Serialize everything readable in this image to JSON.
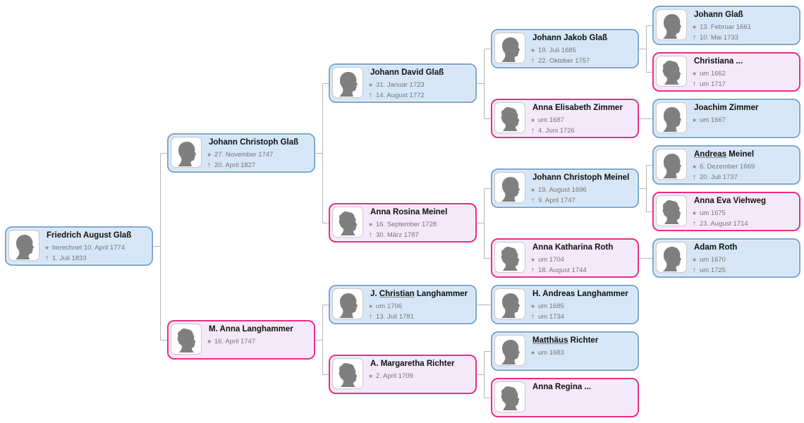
{
  "app": {
    "view": "Ahnenbaum"
  },
  "colors": {
    "male_border": "#7aa6cf",
    "male_bg": "#d6e6f7",
    "female_border": "#ec2a86",
    "female_bg": "#f3e9f8",
    "connector": "#b5b5b5"
  },
  "symbols": {
    "birth": "★",
    "death": "†"
  },
  "persons": [
    {
      "id": "p0",
      "gen": 0,
      "sex": "m",
      "name": "Friedrich August Glaß",
      "name_parts": [
        "Friedrich August Glaß"
      ],
      "birth": "berechnet 10. April 1774",
      "death": "1. Juli 1833"
    },
    {
      "id": "p1",
      "gen": 1,
      "sex": "m",
      "name": "Johann Christoph Glaß",
      "name_parts": [
        "Johann Christoph Glaß"
      ],
      "birth": "27. November 1747",
      "death": "20. April 1827"
    },
    {
      "id": "p2",
      "gen": 1,
      "sex": "f",
      "name": "M. Anna Langhammer",
      "name_parts": [
        "M. Anna Langhammer"
      ],
      "birth": "16. April 1747",
      "death": null
    },
    {
      "id": "p3",
      "gen": 2,
      "sex": "m",
      "name": "Johann David Glaß",
      "name_parts": [
        "Johann David Glaß"
      ],
      "birth": "31. Januar 1723",
      "death": "14. August 1772"
    },
    {
      "id": "p4",
      "gen": 2,
      "sex": "f",
      "name": "Anna Rosina Meinel",
      "name_parts": [
        "Anna Rosina Meinel"
      ],
      "birth": "16. September 1728",
      "death": "30. März 1787"
    },
    {
      "id": "p5",
      "gen": 2,
      "sex": "m",
      "name": "J. Christian Langhammer",
      "name_parts": [
        "J. ",
        "Christian",
        " Langhammer"
      ],
      "underline_index": 1,
      "birth": "um 1706",
      "death": "13. Juli 1781"
    },
    {
      "id": "p6",
      "gen": 2,
      "sex": "f",
      "name": "A. Margaretha Richter",
      "name_parts": [
        "A. Margaretha Richter"
      ],
      "birth": "2. April 1709",
      "death": null
    },
    {
      "id": "p7",
      "gen": 3,
      "sex": "m",
      "name": "Johann Jakob Glaß",
      "name_parts": [
        "Johann Jakob Glaß"
      ],
      "birth": "19. Juli 1685",
      "death": "22. Oktober 1757"
    },
    {
      "id": "p8",
      "gen": 3,
      "sex": "f",
      "name": "Anna Elisabeth Zimmer",
      "name_parts": [
        "Anna Elisabeth Zimmer"
      ],
      "birth": "um 1687",
      "death": "4. Juni 1726"
    },
    {
      "id": "p9",
      "gen": 3,
      "sex": "m",
      "name": "Johann Christoph Meinel",
      "name_parts": [
        "Johann Christoph Meinel"
      ],
      "birth": "19. August 1696",
      "death": "9. April 1747"
    },
    {
      "id": "p10",
      "gen": 3,
      "sex": "f",
      "name": "Anna Katharina Roth",
      "name_parts": [
        "Anna Katharina Roth"
      ],
      "birth": "um 1704",
      "death": "18. August 1744"
    },
    {
      "id": "p11",
      "gen": 3,
      "sex": "m",
      "name": "H. Andreas Langhammer",
      "name_parts": [
        "H. Andreas Langhammer"
      ],
      "birth": "um 1685",
      "death": "um 1734"
    },
    {
      "id": "p12",
      "gen": 3,
      "sex": "m",
      "name": "Matthäus Richter",
      "name_parts": [
        "",
        "Matthäus",
        " Richter"
      ],
      "underline_index": 1,
      "birth": "um 1683",
      "death": null
    },
    {
      "id": "p13",
      "gen": 3,
      "sex": "f",
      "name": "Anna Regina ...",
      "name_parts": [
        "Anna Regina ..."
      ],
      "birth": null,
      "death": null
    },
    {
      "id": "p14",
      "gen": 4,
      "sex": "m",
      "name": "Johann Glaß",
      "name_parts": [
        "Johann Glaß"
      ],
      "birth": "13. Februar 1661",
      "death": "10. Mai 1733"
    },
    {
      "id": "p15",
      "gen": 4,
      "sex": "f",
      "name": "Christiana ...",
      "name_parts": [
        "Christiana ..."
      ],
      "birth": "um 1662",
      "death": "um 1717"
    },
    {
      "id": "p16",
      "gen": 4,
      "sex": "m",
      "name": "Joachim Zimmer",
      "name_parts": [
        "Joachim Zimmer"
      ],
      "birth": "um 1667",
      "death": null
    },
    {
      "id": "p17",
      "gen": 4,
      "sex": "m",
      "name": "Andreas Meinel",
      "name_parts": [
        "",
        "Andreas",
        " Meinel"
      ],
      "underline_index": 1,
      "birth": "6. Dezember 1669",
      "death": "20. Juli 1737"
    },
    {
      "id": "p18",
      "gen": 4,
      "sex": "f",
      "name": "Anna Eva Viehweg",
      "name_parts": [
        "Anna Eva Viehweg"
      ],
      "birth": "um 1675",
      "death": "23. August 1714"
    },
    {
      "id": "p19",
      "gen": 4,
      "sex": "m",
      "name": "Adam Roth",
      "name_parts": [
        "Adam Roth"
      ],
      "birth": "um 1670",
      "death": "um 1725"
    }
  ],
  "relations": [
    {
      "child": "p0",
      "parents": [
        "p1",
        "p2"
      ]
    },
    {
      "child": "p1",
      "parents": [
        "p3",
        "p4"
      ]
    },
    {
      "child": "p2",
      "parents": [
        "p5",
        "p6"
      ]
    },
    {
      "child": "p3",
      "parents": [
        "p7",
        "p8"
      ]
    },
    {
      "child": "p4",
      "parents": [
        "p9",
        "p10"
      ]
    },
    {
      "child": "p5",
      "parents": [
        "p11"
      ]
    },
    {
      "child": "p6",
      "parents": [
        "p12",
        "p13"
      ]
    },
    {
      "child": "p7",
      "parents": [
        "p14",
        "p15"
      ]
    },
    {
      "child": "p8",
      "parents": [
        "p16"
      ]
    },
    {
      "child": "p9",
      "parents": [
        "p17",
        "p18"
      ]
    },
    {
      "child": "p10",
      "parents": [
        "p19"
      ]
    }
  ]
}
